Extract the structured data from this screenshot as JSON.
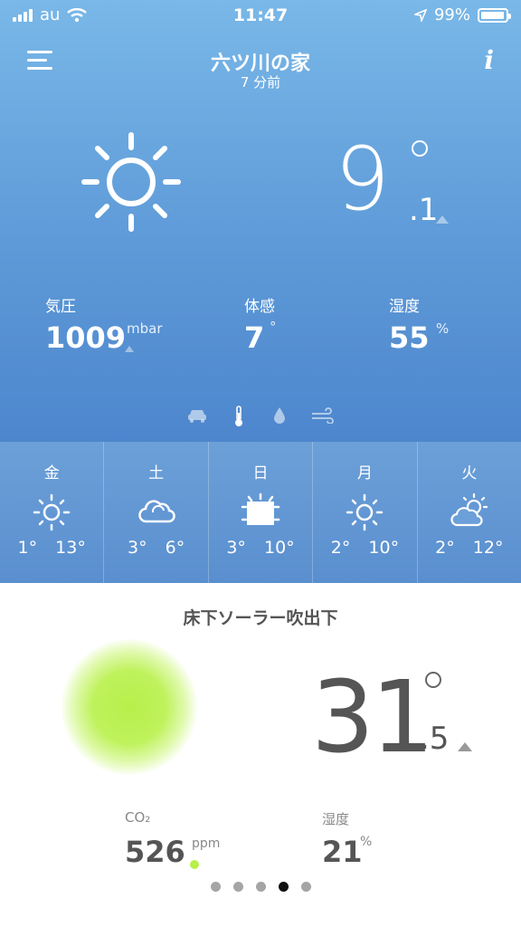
{
  "status": {
    "carrier": "au",
    "time": "11:47",
    "battery": "99%",
    "battery_level": 0.99
  },
  "header": {
    "title": "六ツ川の家",
    "subtitle": "7 分前"
  },
  "outdoor": {
    "temp_int": "9",
    "temp_dec": ".1",
    "metrics": [
      {
        "label": "気圧",
        "value": "1009",
        "unit": "mbar"
      },
      {
        "label": "体感",
        "value": "7",
        "unit": "°"
      },
      {
        "label": "湿度",
        "value": "55",
        "unit": "%"
      }
    ]
  },
  "modes": [
    "car-icon",
    "thermometer-icon",
    "drop-icon",
    "wind-icon"
  ],
  "forecast": [
    {
      "day": "金",
      "icon": "sun-icon",
      "min": "1°",
      "max": "13°"
    },
    {
      "day": "土",
      "icon": "cloud-icon",
      "min": "3°",
      "max": "6°"
    },
    {
      "day": "日",
      "icon": "snow-sun-icon",
      "min": "3°",
      "max": "10°"
    },
    {
      "day": "月",
      "icon": "sun-icon",
      "min": "2°",
      "max": "10°"
    },
    {
      "day": "火",
      "icon": "partly-cloudy-icon",
      "min": "2°",
      "max": "12°"
    }
  ],
  "module": {
    "title": "床下ソーラー吹出下",
    "temp_int": "31",
    "temp_dec": ".5",
    "co2_label": "CO₂",
    "co2_value": "526",
    "co2_unit": "ppm",
    "hum_label": "湿度",
    "hum_value": "21",
    "hum_unit": "%",
    "glow_color": "#b8ef4b"
  },
  "pager": {
    "count": 5,
    "active": 3
  }
}
